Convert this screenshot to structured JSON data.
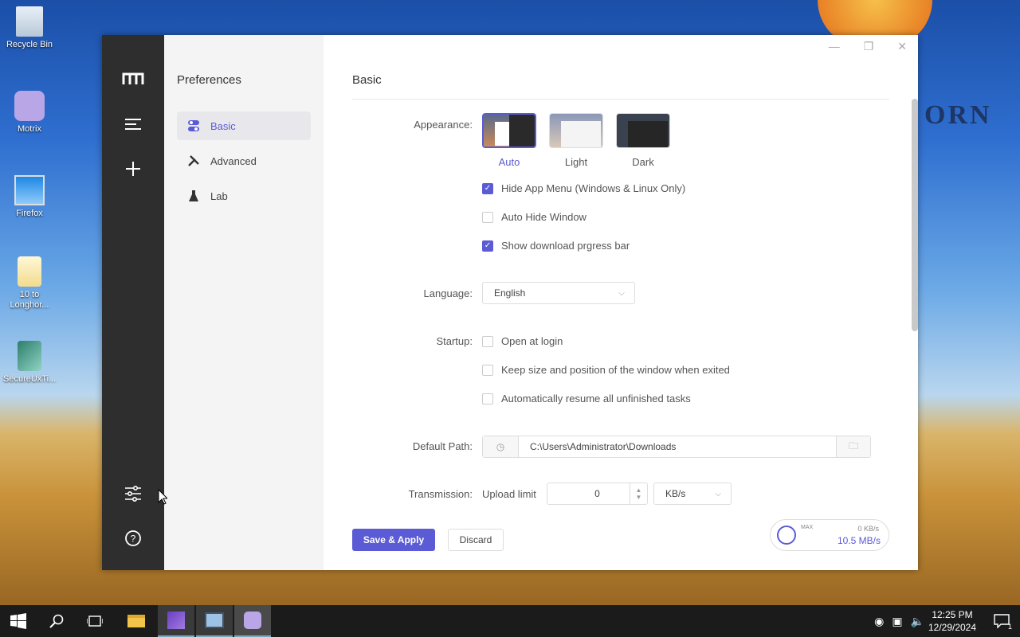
{
  "desktop": {
    "icons": [
      {
        "label": "Recycle Bin"
      },
      {
        "label": "Motrix"
      },
      {
        "label": "Firefox"
      },
      {
        "label": "10 to Longhor..."
      },
      {
        "label": "SecureUxTi..."
      }
    ],
    "wallpaper_text": "ORN"
  },
  "window": {
    "sidebar_title": "Preferences",
    "nav": [
      {
        "label": "Basic"
      },
      {
        "label": "Advanced"
      },
      {
        "label": "Lab"
      }
    ],
    "section_title": "Basic",
    "appearance": {
      "label": "Appearance:",
      "options": [
        {
          "label": "Auto"
        },
        {
          "label": "Light"
        },
        {
          "label": "Dark"
        }
      ],
      "selected": "Auto"
    },
    "checkboxes": [
      {
        "label": "Hide App Menu (Windows & Linux Only)",
        "checked": true
      },
      {
        "label": "Auto Hide Window",
        "checked": false
      },
      {
        "label": "Show download prgress bar",
        "checked": true
      }
    ],
    "language": {
      "label": "Language:",
      "value": "English"
    },
    "startup": {
      "label": "Startup:",
      "options": [
        {
          "label": "Open at login",
          "checked": false
        },
        {
          "label": "Keep size and position of the window when exited",
          "checked": false
        },
        {
          "label": "Automatically resume all unfinished tasks",
          "checked": false
        }
      ]
    },
    "default_path": {
      "label": "Default Path:",
      "value": "C:\\Users\\Administrator\\Downloads"
    },
    "transmission": {
      "label": "Transmission:",
      "upload_label": "Upload limit",
      "upload_value": "0",
      "unit": "KB/s"
    },
    "save_label": "Save & Apply",
    "discard_label": "Discard",
    "speed": {
      "max_label": "MAX",
      "upload": "0 KB/s",
      "download": "10.5 MB/s"
    }
  },
  "taskbar": {
    "time": "12:25 PM",
    "date": "12/29/2024",
    "notification_count": "1"
  },
  "colors": {
    "accent": "#5b5bd6",
    "rail": "#2e2e2e",
    "sidebar": "#f4f4f5"
  }
}
